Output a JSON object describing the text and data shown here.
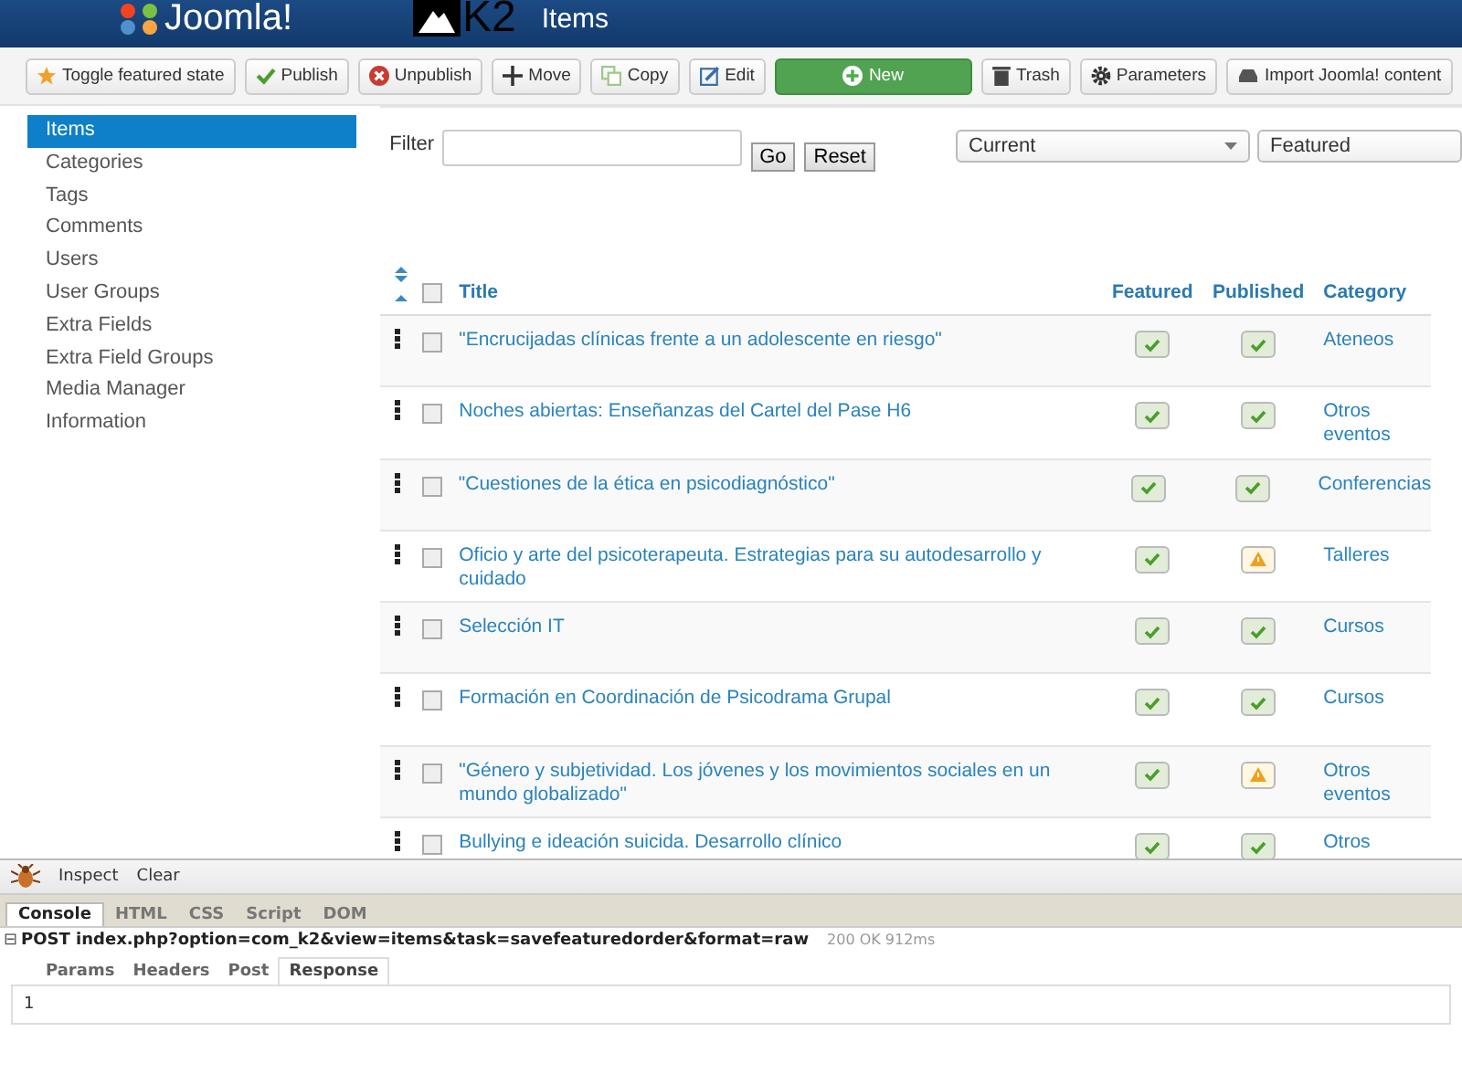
{
  "header": {
    "joomla_logo": "Joomla!",
    "k2_logo": "K2",
    "title": "Items"
  },
  "toolbar": [
    {
      "label": "Toggle featured state",
      "kind": "default"
    },
    {
      "label": "Publish",
      "kind": "default"
    },
    {
      "label": "Unpublish",
      "kind": "default"
    },
    {
      "label": "Move",
      "kind": "default"
    },
    {
      "label": "Copy",
      "kind": "default"
    },
    {
      "label": "Edit",
      "kind": "default"
    },
    {
      "label": "New",
      "kind": "primary"
    },
    {
      "label": "Trash",
      "kind": "default"
    },
    {
      "label": "Parameters",
      "kind": "default"
    },
    {
      "label": "Import Joomla! content",
      "kind": "default"
    }
  ],
  "sidebar": {
    "items": [
      {
        "label": "Items",
        "selected": true
      },
      {
        "label": "Categories",
        "selected": false
      },
      {
        "label": "Tags",
        "selected": false
      },
      {
        "label": "Comments",
        "selected": false
      },
      {
        "label": "Users",
        "selected": false
      },
      {
        "label": "User Groups",
        "selected": false
      },
      {
        "label": "Extra Fields",
        "selected": false
      },
      {
        "label": "Extra Field Groups",
        "selected": false
      },
      {
        "label": "Media Manager",
        "selected": false
      },
      {
        "label": "Information",
        "selected": false
      }
    ]
  },
  "filter": {
    "label": "Filter",
    "go": "Go",
    "reset": "Reset",
    "selects": [
      "Current",
      "Featured"
    ]
  },
  "table": {
    "select_all_checked": false,
    "columns": [
      "Title",
      "Featured",
      "Published",
      "Category"
    ],
    "rows": [
      {
        "title": "\"Encrucijadas clínicas frente a un adolescente en riesgo\"",
        "checked": false,
        "featured": true,
        "published": true,
        "category": "Ateneos"
      },
      {
        "title": "Noches abiertas: Enseñanzas del Cartel del Pase H6",
        "checked": false,
        "featured": true,
        "published": true,
        "category": "Otros eventos"
      },
      {
        "title": "\"Cuestiones de la ética en psicodiagnóstico\"",
        "checked": false,
        "featured": true,
        "published": true,
        "category": "Conferencias"
      },
      {
        "title": "Oficio y arte del psicoterapeuta. Estrategias para su autodesarrollo y cuidado",
        "checked": false,
        "featured": true,
        "published": false,
        "category": "Talleres"
      },
      {
        "title": "Selección IT",
        "checked": false,
        "featured": true,
        "published": true,
        "category": "Cursos"
      },
      {
        "title": "Formación en Coordinación de Psicodrama Grupal",
        "checked": false,
        "featured": true,
        "published": true,
        "category": "Cursos"
      },
      {
        "title": "\"Género y subjetividad. Los jóvenes y los movimientos sociales en un mundo globalizado\"",
        "checked": false,
        "featured": true,
        "published": false,
        "category": "Otros eventos"
      },
      {
        "title": "Bullying e ideación suicida. Desarrollo clínico",
        "checked": false,
        "featured": true,
        "published": true,
        "category": "Otros"
      }
    ]
  },
  "devtools": {
    "toolbar": [
      "Inspect",
      "Clear"
    ],
    "tabs": [
      {
        "label": "Console",
        "selected": true
      },
      {
        "label": "HTML",
        "selected": false
      },
      {
        "label": "CSS",
        "selected": false
      },
      {
        "label": "Script",
        "selected": false
      },
      {
        "label": "DOM",
        "selected": false
      }
    ],
    "request": {
      "expander": "⊟",
      "line": "POST index.php?option=com_k2&view=items&task=savefeaturedorder&format=raw",
      "status": "200 OK 912ms"
    },
    "subtabs": [
      {
        "label": "Params",
        "selected": false
      },
      {
        "label": "Headers",
        "selected": false
      },
      {
        "label": "Post",
        "selected": false
      },
      {
        "label": "Response",
        "selected": true
      }
    ],
    "response": "1"
  }
}
